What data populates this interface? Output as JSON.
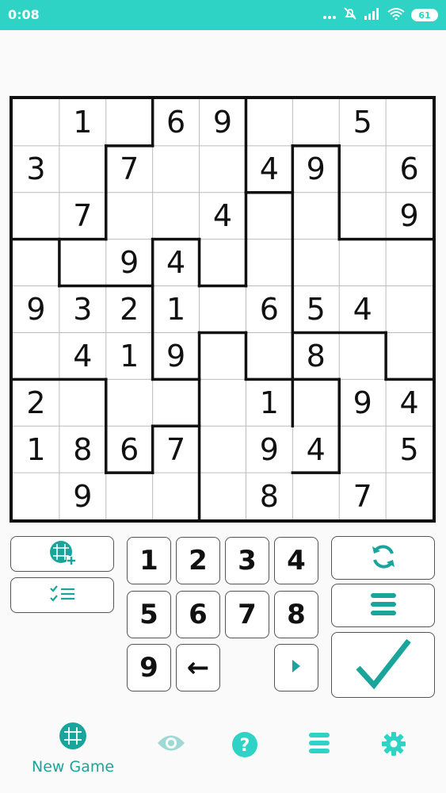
{
  "status_bar": {
    "time": "0:08",
    "battery": "61"
  },
  "puzzle": {
    "rows": [
      [
        "",
        "1",
        "",
        "6",
        "9",
        "",
        "",
        "5",
        ""
      ],
      [
        "3",
        "",
        "7",
        "",
        "",
        "4",
        "9",
        "",
        "6"
      ],
      [
        "",
        "7",
        "",
        "",
        "4",
        "",
        "",
        "",
        "9"
      ],
      [
        "",
        "",
        "9",
        "4",
        "",
        "",
        "",
        "",
        ""
      ],
      [
        "9",
        "3",
        "2",
        "1",
        "",
        "6",
        "5",
        "4",
        ""
      ],
      [
        "",
        "4",
        "1",
        "9",
        "",
        "",
        "8",
        "",
        ""
      ],
      [
        "2",
        "",
        "",
        "",
        "",
        "1",
        "",
        "9",
        "4"
      ],
      [
        "1",
        "8",
        "6",
        "7",
        "",
        "9",
        "4",
        "",
        "5"
      ],
      [
        "",
        "9",
        "",
        "",
        "",
        "8",
        "",
        "7",
        ""
      ]
    ]
  },
  "keypad": {
    "keys": [
      "1",
      "2",
      "3",
      "4",
      "5",
      "6",
      "7",
      "8",
      "9"
    ],
    "backspace": "←"
  },
  "icons": {
    "grid_add": "grid-plus-icon",
    "checklist": "checklist-icon",
    "refresh": "refresh-icon",
    "menu": "menu-icon",
    "check": "check-icon",
    "play": "play-icon"
  },
  "bottom_nav": {
    "new_game_label": "New Game"
  },
  "colors": {
    "accent": "#1aa59c",
    "status": "#2ed3c6"
  }
}
